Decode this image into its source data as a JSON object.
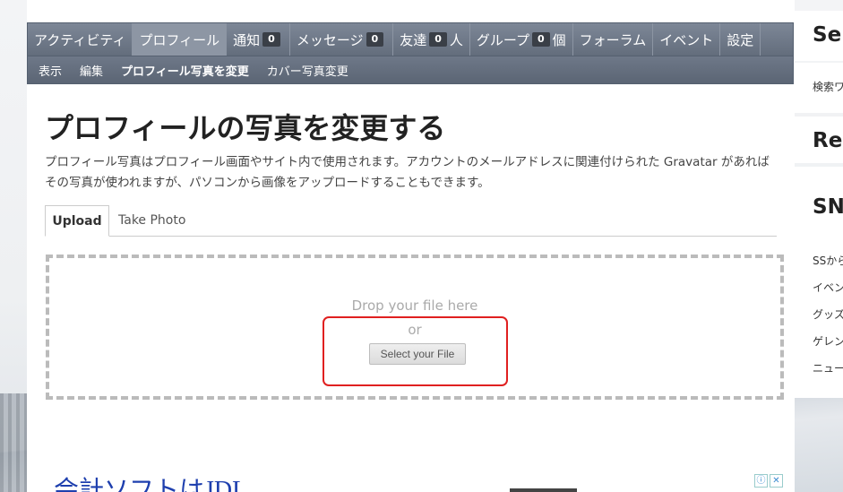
{
  "nav": {
    "items": [
      {
        "label": "アクティビティ"
      },
      {
        "label": "プロフィール"
      },
      {
        "label": "通知",
        "count": "0"
      },
      {
        "label": "メッセージ",
        "count": "0"
      },
      {
        "label": "友達",
        "count": "0",
        "suffix": "人"
      },
      {
        "label": "グループ",
        "count": "0",
        "suffix": "個"
      },
      {
        "label": "フォーラム"
      },
      {
        "label": "イベント"
      },
      {
        "label": "設定"
      }
    ],
    "sub_items": [
      {
        "label": "表示"
      },
      {
        "label": "編集"
      },
      {
        "label": "プロフィール写真を変更"
      },
      {
        "label": "カバー写真変更"
      }
    ]
  },
  "page": {
    "title": "プロフィールの写真を変更する",
    "description": "プロフィール写真はプロフィール画面やサイト内で使用されます。アカウントのメールアドレスに関連付けられた Gravatar があればその写真が使われますが、パソコンから画像をアップロードすることもできます。"
  },
  "tabs": {
    "upload": "Upload",
    "take_photo": "Take Photo"
  },
  "dropzone": {
    "drop_text": "Drop your file here",
    "or_text": "or",
    "select_button": "Select your File"
  },
  "sidebar": {
    "widget1_title": "Se",
    "widget1_item": "検索ワ",
    "widget2_title": "Re",
    "widget3_title": "SN",
    "widget3_items": [
      "SSから",
      "イベン",
      "グッズ",
      "ゲレン",
      "ニュー"
    ]
  },
  "ad": {
    "text": "会計ソフトはJDL"
  },
  "colors": {
    "nav_bg": "#6b7585",
    "highlight": "#e02020",
    "title_text": "#222222"
  }
}
